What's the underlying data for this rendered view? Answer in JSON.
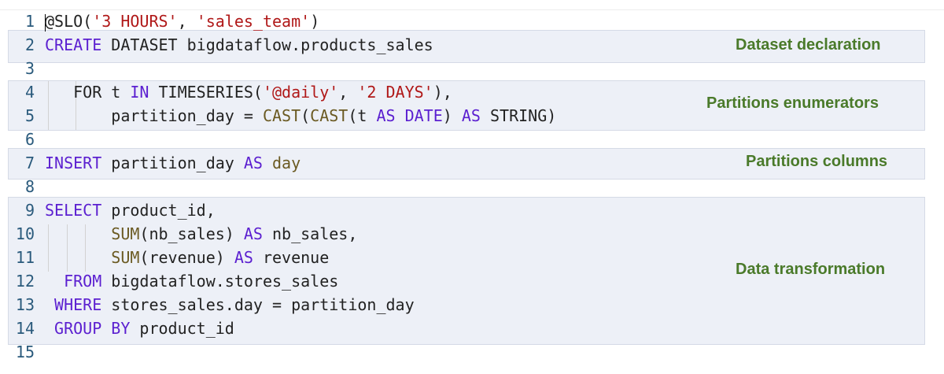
{
  "annotations": {
    "dataset": "Dataset declaration",
    "partitions_enum": "Partitions enumerators",
    "partitions_cols": "Partitions columns",
    "transform": "Data transformation"
  },
  "lines": [
    {
      "n": "1",
      "tokens": [
        {
          "t": "@SLO(",
          "c": "p"
        },
        {
          "t": "'3 HOURS'",
          "c": "s"
        },
        {
          "t": ", ",
          "c": "p"
        },
        {
          "t": "'sales_team'",
          "c": "s"
        },
        {
          "t": ")",
          "c": "p"
        }
      ]
    },
    {
      "n": "2",
      "tokens": [
        {
          "t": "CREATE",
          "c": "k"
        },
        {
          "t": " DATASET bigdataflow.products_sales",
          "c": "p"
        }
      ]
    },
    {
      "n": "3",
      "tokens": []
    },
    {
      "n": "4",
      "tokens": [
        {
          "t": "   FOR t ",
          "c": "p"
        },
        {
          "t": "IN",
          "c": "k"
        },
        {
          "t": " TIMESERIES(",
          "c": "p"
        },
        {
          "t": "'@daily'",
          "c": "s"
        },
        {
          "t": ", ",
          "c": "p"
        },
        {
          "t": "'2 DAYS'",
          "c": "s"
        },
        {
          "t": "),",
          "c": "p"
        }
      ]
    },
    {
      "n": "5",
      "tokens": [
        {
          "t": "       partition_day = ",
          "c": "p"
        },
        {
          "t": "CAST",
          "c": "f"
        },
        {
          "t": "(",
          "c": "p"
        },
        {
          "t": "CAST",
          "c": "f"
        },
        {
          "t": "(t ",
          "c": "p"
        },
        {
          "t": "AS DATE",
          "c": "k"
        },
        {
          "t": ") ",
          "c": "p"
        },
        {
          "t": "AS",
          "c": "k"
        },
        {
          "t": " STRING)",
          "c": "p"
        }
      ]
    },
    {
      "n": "6",
      "tokens": []
    },
    {
      "n": "7",
      "tokens": [
        {
          "t": "INSERT",
          "c": "k"
        },
        {
          "t": " partition_day ",
          "c": "p"
        },
        {
          "t": "AS",
          "c": "k"
        },
        {
          "t": " ",
          "c": "p"
        },
        {
          "t": "day",
          "c": "f"
        }
      ]
    },
    {
      "n": "8",
      "tokens": []
    },
    {
      "n": "9",
      "tokens": [
        {
          "t": "SELECT",
          "c": "k"
        },
        {
          "t": " product_id,",
          "c": "p"
        }
      ]
    },
    {
      "n": "10",
      "tokens": [
        {
          "t": "       ",
          "c": "p"
        },
        {
          "t": "SUM",
          "c": "f"
        },
        {
          "t": "(nb_sales) ",
          "c": "p"
        },
        {
          "t": "AS",
          "c": "k"
        },
        {
          "t": " nb_sales,",
          "c": "p"
        }
      ]
    },
    {
      "n": "11",
      "tokens": [
        {
          "t": "       ",
          "c": "p"
        },
        {
          "t": "SUM",
          "c": "f"
        },
        {
          "t": "(revenue) ",
          "c": "p"
        },
        {
          "t": "AS",
          "c": "k"
        },
        {
          "t": " revenue",
          "c": "p"
        }
      ]
    },
    {
      "n": "12",
      "tokens": [
        {
          "t": "  FROM",
          "c": "k"
        },
        {
          "t": " bigdataflow.stores_sales",
          "c": "p"
        }
      ]
    },
    {
      "n": "13",
      "tokens": [
        {
          "t": " WHERE",
          "c": "k"
        },
        {
          "t": " stores_sales.day = partition_day",
          "c": "p"
        }
      ]
    },
    {
      "n": "14",
      "tokens": [
        {
          "t": " GROUP BY",
          "c": "k"
        },
        {
          "t": " product_id",
          "c": "p"
        }
      ]
    },
    {
      "n": "15",
      "tokens": []
    }
  ]
}
